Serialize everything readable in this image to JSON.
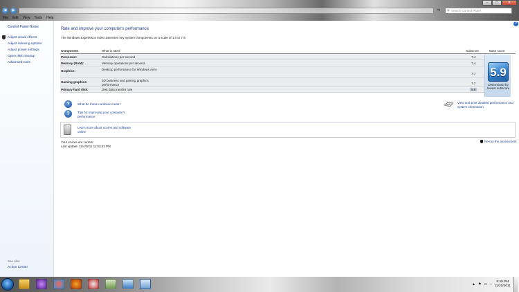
{
  "menu": [
    "File",
    "Edit",
    "View",
    "Tools",
    "Help"
  ],
  "search": {
    "placeholder": "Search Control Panel"
  },
  "window_buttons": {
    "minimize": "–",
    "maximize": "□",
    "close": "X"
  },
  "nav": {
    "back": "◀",
    "forward": "▶"
  },
  "sidebar": {
    "home": "Control Panel Home",
    "links": [
      "Adjust visual effects",
      "Adjust indexing options",
      "Adjust power settings",
      "Open disk cleanup",
      "Advanced tools"
    ],
    "see_also": "See also",
    "action_center": "Action Center"
  },
  "main": {
    "title": "Rate and improve your computer's performance",
    "intro": "The Windows Experience Index assesses key system components on a scale of 1.0 to 7.9.",
    "headers": {
      "component": "Component",
      "what": "What is rated",
      "subscore": "Subscore",
      "base": "Base score"
    },
    "rows": [
      {
        "component": "Processor:",
        "what": "Calculations per second",
        "subscore": "7.4"
      },
      {
        "component": "Memory (RAM):",
        "what": "Memory operations per second",
        "subscore": "7.4"
      },
      {
        "component": "Graphics:",
        "what": "Desktop performance for Windows Aero",
        "subscore": "7.7"
      },
      {
        "component": "Gaming graphics:",
        "what": "3D business and gaming graphics performance",
        "subscore": "7.7"
      },
      {
        "component": "Primary hard disk:",
        "what": "Disk data transfer rate",
        "subscore": "5.9"
      }
    ],
    "base_score": "5.9",
    "base_caption": "Determined by lowest subscore",
    "links": {
      "meaning": "What do these numbers mean?",
      "tips": "Tips for improving your computer's performance.",
      "print": "View and print detailed performance and system information",
      "learn": "Learn more about scores and software online"
    },
    "status": {
      "current": "Your scores are current",
      "last_update": "Last update: 11/4/2011 11:53:43 PM",
      "rerun": "Re-run the assessment"
    }
  },
  "taskbar": {
    "time": "8:49 PM",
    "date": "11/20/2011",
    "tray": [
      "▲",
      "⚑",
      "▭",
      "♪"
    ],
    "icons": [
      "media-player-icon",
      "itunes-icon",
      "msn-icon",
      "firefox-icon",
      "chrome-icon",
      "games-icon",
      "network-icon",
      "control-panel-icon"
    ]
  },
  "colors": {
    "link": "#1c3f8f",
    "title": "#1e3b87",
    "score_tile": "#3f8ad3"
  }
}
